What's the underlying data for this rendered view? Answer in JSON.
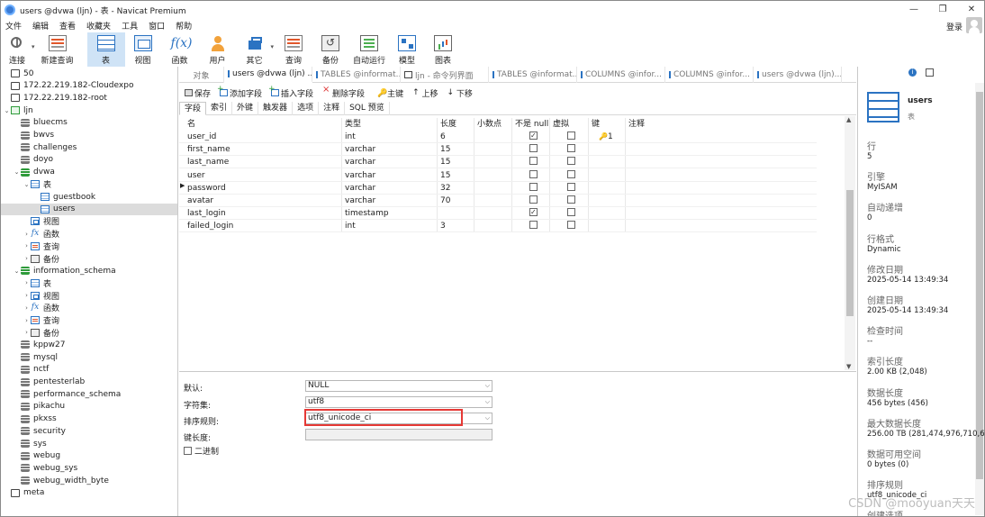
{
  "window": {
    "title": "users @dvwa (ljn) - 表 - Navicat Premium",
    "controls": [
      "—",
      "❐",
      "✕"
    ]
  },
  "menu": [
    "文件",
    "编辑",
    "查看",
    "收藏夹",
    "工具",
    "窗口",
    "帮助"
  ],
  "login_label": "登录",
  "toolbar": [
    {
      "label": "连接",
      "icon": "connection-icon"
    },
    {
      "label": "新建查询",
      "icon": "new-query-icon"
    },
    {
      "label": "表",
      "icon": "table-icon",
      "active": true
    },
    {
      "label": "视图",
      "icon": "view-icon"
    },
    {
      "label": "函数",
      "icon": "function-icon"
    },
    {
      "label": "用户",
      "icon": "user-icon"
    },
    {
      "label": "其它",
      "icon": "other-icon"
    },
    {
      "label": "查询",
      "icon": "query-icon"
    },
    {
      "label": "备份",
      "icon": "backup-icon"
    },
    {
      "label": "自动运行",
      "icon": "automation-icon"
    },
    {
      "label": "模型",
      "icon": "model-icon"
    },
    {
      "label": "图表",
      "icon": "chart-icon"
    }
  ],
  "tree": [
    {
      "label": "50",
      "icon": "connection",
      "depth": 0
    },
    {
      "label": "172.22.219.182-Cloudexpo",
      "icon": "connection",
      "depth": 0
    },
    {
      "label": "172.22.219.182-root",
      "icon": "connection",
      "depth": 0
    },
    {
      "label": "ljn",
      "icon": "connection-open",
      "depth": 0,
      "expanded": true
    },
    {
      "label": "bluecms",
      "icon": "db",
      "depth": 1
    },
    {
      "label": "bwvs",
      "icon": "db",
      "depth": 1
    },
    {
      "label": "challenges",
      "icon": "db",
      "depth": 1
    },
    {
      "label": "doyo",
      "icon": "db",
      "depth": 1
    },
    {
      "label": "dvwa",
      "icon": "db-open",
      "depth": 1,
      "expanded": true
    },
    {
      "label": "表",
      "icon": "table",
      "depth": 2,
      "expanded": true
    },
    {
      "label": "guestbook",
      "icon": "table",
      "depth": 3
    },
    {
      "label": "users",
      "icon": "table",
      "depth": 3,
      "selected": true
    },
    {
      "label": "视图",
      "icon": "view",
      "depth": 2
    },
    {
      "label": "函数",
      "icon": "func",
      "depth": 2,
      "collapsed": true
    },
    {
      "label": "查询",
      "icon": "query",
      "depth": 2,
      "collapsed": true
    },
    {
      "label": "备份",
      "icon": "backup",
      "depth": 2,
      "collapsed": true
    },
    {
      "label": "information_schema",
      "icon": "db-open",
      "depth": 1,
      "expanded": true
    },
    {
      "label": "表",
      "icon": "table",
      "depth": 2,
      "collapsed": true
    },
    {
      "label": "视图",
      "icon": "view",
      "depth": 2,
      "collapsed": true
    },
    {
      "label": "函数",
      "icon": "func",
      "depth": 2,
      "collapsed": true
    },
    {
      "label": "查询",
      "icon": "query",
      "depth": 2,
      "collapsed": true
    },
    {
      "label": "备份",
      "icon": "backup",
      "depth": 2,
      "collapsed": true
    },
    {
      "label": "kppw27",
      "icon": "db",
      "depth": 1
    },
    {
      "label": "mysql",
      "icon": "db",
      "depth": 1
    },
    {
      "label": "nctf",
      "icon": "db",
      "depth": 1
    },
    {
      "label": "pentesterlab",
      "icon": "db",
      "depth": 1
    },
    {
      "label": "performance_schema",
      "icon": "db",
      "depth": 1
    },
    {
      "label": "pikachu",
      "icon": "db",
      "depth": 1
    },
    {
      "label": "pkxss",
      "icon": "db",
      "depth": 1
    },
    {
      "label": "security",
      "icon": "db",
      "depth": 1
    },
    {
      "label": "sys",
      "icon": "db",
      "depth": 1
    },
    {
      "label": "webug",
      "icon": "db",
      "depth": 1
    },
    {
      "label": "webug_sys",
      "icon": "db",
      "depth": 1
    },
    {
      "label": "webug_width_byte",
      "icon": "db",
      "depth": 1
    },
    {
      "label": "meta",
      "icon": "connection",
      "depth": 0
    }
  ],
  "tabs": [
    {
      "label": "对象",
      "icon": ""
    },
    {
      "label": "users @dvwa (ljn) ...",
      "icon": "table",
      "active": true
    },
    {
      "label": "TABLES @informat...",
      "icon": "table"
    },
    {
      "label": "ljn - 命令列界面",
      "icon": "term"
    },
    {
      "label": "TABLES @informat...",
      "icon": "table"
    },
    {
      "label": "COLUMNS @infor...",
      "icon": "table"
    },
    {
      "label": "COLUMNS @infor...",
      "icon": "table"
    },
    {
      "label": "users @dvwa (ljn)...",
      "icon": "table"
    }
  ],
  "design_actions": {
    "save": "保存",
    "add_field": "添加字段",
    "insert_field": "插入字段",
    "delete_field": "删除字段",
    "primary_key": "主键",
    "move_up": "上移",
    "move_down": "下移"
  },
  "subtabs": [
    "字段",
    "索引",
    "外键",
    "触发器",
    "选项",
    "注释",
    "SQL 预览"
  ],
  "columns": [
    "名",
    "类型",
    "长度",
    "小数点",
    "不是 null",
    "虚拟",
    "键",
    "注释"
  ],
  "fields": [
    {
      "name": "user_id",
      "type": "int",
      "length": "6",
      "decimal": "",
      "notnull": true,
      "virtual": false,
      "key": "1"
    },
    {
      "name": "first_name",
      "type": "varchar",
      "length": "15",
      "decimal": "",
      "notnull": false,
      "virtual": false,
      "key": ""
    },
    {
      "name": "last_name",
      "type": "varchar",
      "length": "15",
      "decimal": "",
      "notnull": false,
      "virtual": false,
      "key": ""
    },
    {
      "name": "user",
      "type": "varchar",
      "length": "15",
      "decimal": "",
      "notnull": false,
      "virtual": false,
      "key": ""
    },
    {
      "name": "password",
      "type": "varchar",
      "length": "32",
      "decimal": "",
      "notnull": false,
      "virtual": false,
      "key": "",
      "current": true
    },
    {
      "name": "avatar",
      "type": "varchar",
      "length": "70",
      "decimal": "",
      "notnull": false,
      "virtual": false,
      "key": ""
    },
    {
      "name": "last_login",
      "type": "timestamp",
      "length": "",
      "decimal": "",
      "notnull": true,
      "virtual": false,
      "key": ""
    },
    {
      "name": "failed_login",
      "type": "int",
      "length": "3",
      "decimal": "",
      "notnull": false,
      "virtual": false,
      "key": ""
    }
  ],
  "field_props": {
    "default_label": "默认:",
    "default_value": "NULL",
    "charset_label": "字符集:",
    "charset_value": "utf8",
    "collation_label": "排序规则:",
    "collation_value": "utf8_unicode_ci",
    "keylength_label": "键长度:",
    "keylength_value": "",
    "binary_label": "二进制"
  },
  "info_panel": {
    "name": "users",
    "subtitle": "表",
    "items": [
      {
        "label": "行",
        "value": "5"
      },
      {
        "label": "引擎",
        "value": "MyISAM"
      },
      {
        "label": "自动递增",
        "value": "0"
      },
      {
        "label": "行格式",
        "value": "Dynamic"
      },
      {
        "label": "修改日期",
        "value": "2025-05-14 13:49:34"
      },
      {
        "label": "创建日期",
        "value": "2025-05-14 13:49:34"
      },
      {
        "label": "检查时间",
        "value": "--"
      },
      {
        "label": "索引长度",
        "value": "2.00 KB (2,048)"
      },
      {
        "label": "数据长度",
        "value": "456 bytes (456)"
      },
      {
        "label": "最大数据长度",
        "value": "256.00 TB (281,474,976,710,6"
      },
      {
        "label": "数据可用空间",
        "value": "0 bytes (0)"
      },
      {
        "label": "排序规则",
        "value": "utf8_unicode_ci"
      },
      {
        "label": "创建选项",
        "value": ""
      }
    ]
  },
  "watermark": "CSDN @mooyuan天天"
}
